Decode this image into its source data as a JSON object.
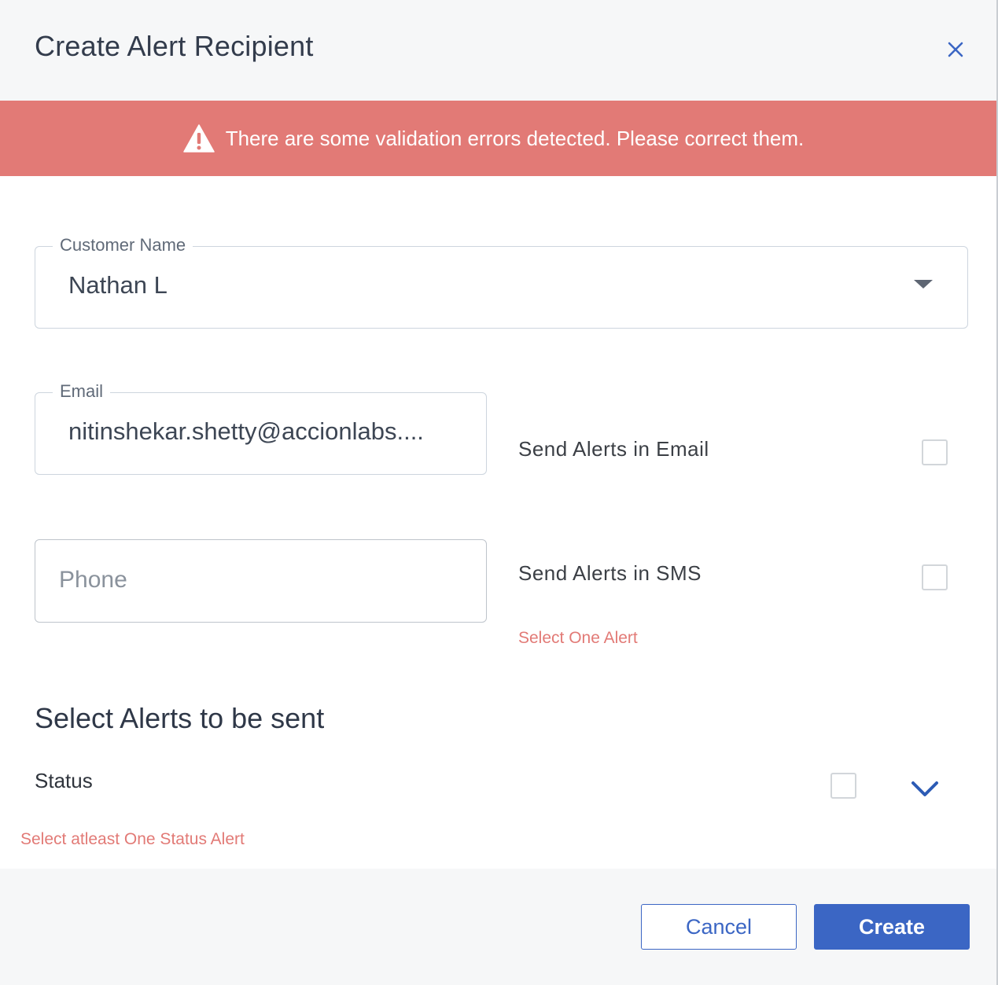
{
  "dialog": {
    "title": "Create Alert Recipient",
    "close_icon": "close-icon"
  },
  "banner": {
    "icon": "warning-icon",
    "text": "There are some validation errors detected. Please correct them.",
    "color": "#e27a76"
  },
  "customer": {
    "label": "Customer Name",
    "value": "Nathan L",
    "icon": "caret-down-icon"
  },
  "email": {
    "label": "Email",
    "value": "nitinshekar.shetty@accionlabs...."
  },
  "phone": {
    "placeholder": "Phone",
    "value": ""
  },
  "alerts": {
    "email_option": "Send Alerts in Email",
    "email_checked": false,
    "sms_option": "Send Alerts in SMS",
    "sms_checked": false,
    "error": "Select One Alert"
  },
  "section": {
    "title": "Select Alerts to be sent",
    "status_label": "Status",
    "status_checked": false,
    "expand_icon": "chevron-down-icon",
    "status_error": "Select atleast One Status Alert"
  },
  "footer": {
    "cancel_label": "Cancel",
    "create_label": "Create"
  },
  "colors": {
    "accent": "#3b66c4",
    "error_text": "#e27a76",
    "header_bg": "#f6f7f8"
  }
}
